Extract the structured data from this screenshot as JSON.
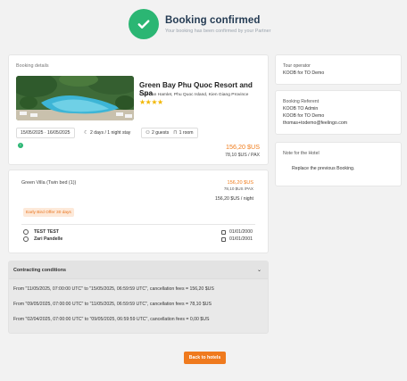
{
  "header": {
    "title": "Booking confirmed",
    "subtitle": "Your booking has been confirmed by your Partner"
  },
  "booking": {
    "section_label": "Booking details",
    "hotel_name": "Green Bay Phu Quoc Resort and Spa",
    "address": "Cua Can Hamlet, Phu Quoc Island, Kien Giang Province",
    "stars": "★★★★",
    "dates": "15/05/2025 · 16/05/2025",
    "duration": "2 days / 1 night stay",
    "guests": "2 guests",
    "rooms": "1 room",
    "total_price": "156,20 $US",
    "price_per_pax": "78,10 $US / PAX",
    "info_icon": "!"
  },
  "room": {
    "name": "Green Villa (Twin bed (1))",
    "price": "156,20 $US",
    "price_pax": "78,10 $US /PAX",
    "price_night": "156,20 $US / night",
    "offer": "Early Bird Offer 30 days",
    "guests": [
      {
        "name": "TEST TEST",
        "dob": "01/01/2000"
      },
      {
        "name": "Zari Pandelle",
        "dob": "01/01/2001"
      }
    ]
  },
  "contracting": {
    "title": "Contracting conditions",
    "chevron": "⌄",
    "lines": [
      "From \"11/05/2025, 07:00:00 UTC\" to \"15/05/2025, 06:59:59 UTC\", cancellation fees = 156,20 $US",
      "From \"09/05/2025, 07:00:00 UTC\" to \"11/05/2025, 06:59:59 UTC\", cancellation fees = 78,10 $US",
      "From \"02/04/2025, 07:00:00 UTC\" to \"09/05/2025, 06:59:59 UTC\", cancellation fees = 0,00 $US"
    ]
  },
  "tour_operator": {
    "label": "Tour operator",
    "value": "KOOB for TO Demo"
  },
  "booking_referent": {
    "label": "Booking Referent",
    "lines": [
      "KOOB TO Admin",
      "KOOB for TO Demo",
      "thomas+todemo@feelingo.com"
    ]
  },
  "hotel_note": {
    "label": "Note for the Hotel",
    "value": "Replace the previous Booking."
  },
  "actions": {
    "back_label": "Back to hotels"
  },
  "colors": {
    "success": "#2bb673",
    "accent": "#ef7a1e",
    "title": "#243b53"
  }
}
